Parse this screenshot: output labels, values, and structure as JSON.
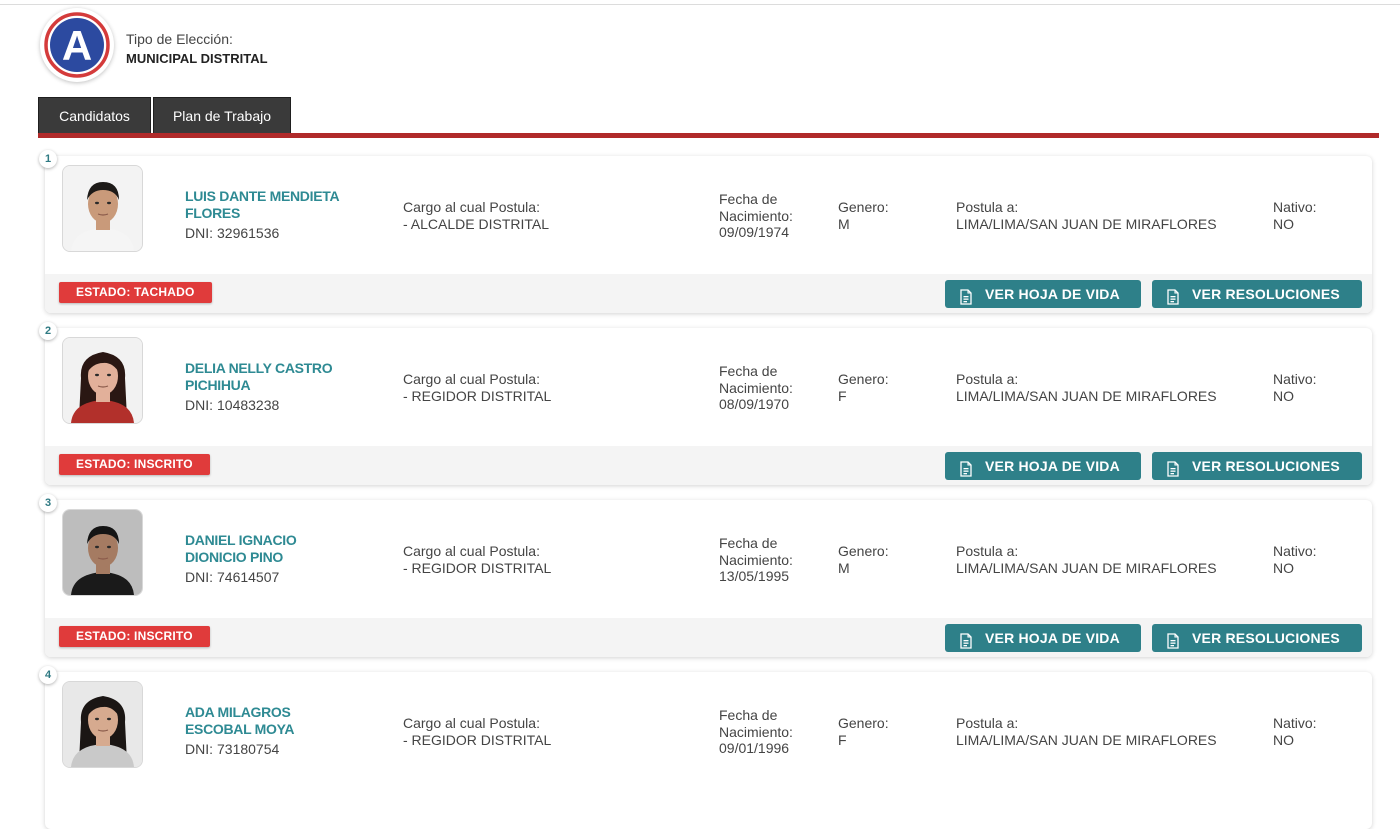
{
  "header": {
    "logo_letter": "A",
    "election_type_label": "Tipo de Elección:",
    "election_type_value": "MUNICIPAL DISTRITAL"
  },
  "tabs": [
    {
      "label": "Candidatos"
    },
    {
      "label": "Plan de Trabajo"
    }
  ],
  "labels": {
    "dni": "DNI:",
    "cargo": "Cargo al cual Postula:",
    "fecha_line1": "Fecha de",
    "fecha_line2": "Nacimiento:",
    "genero": "Genero:",
    "postula": "Postula a:",
    "nativo": "Nativo:",
    "btn_hoja": "VER HOJA DE VIDA",
    "btn_resoluciones": "VER RESOLUCIONES"
  },
  "colors": {
    "accent_teal": "#2e8089",
    "name_teal": "#2e8a93",
    "status_red": "#e03b3b",
    "tab_bar_red": "#b02a2a"
  },
  "candidates": [
    {
      "number": "1",
      "name_line1": "LUIS DANTE MENDIETA",
      "name_line2": "FLORES",
      "dni": "32961536",
      "cargo": "- ALCALDE DISTRITAL",
      "fecha": "09/09/1974",
      "genero": "M",
      "postula": "LIMA/LIMA/SAN JUAN DE MIRAFLORES",
      "nativo": "NO",
      "estado": "ESTADO: TACHADO"
    },
    {
      "number": "2",
      "name_line1": "DELIA NELLY CASTRO",
      "name_line2": "PICHIHUA",
      "dni": "10483238",
      "cargo": "- REGIDOR DISTRITAL",
      "fecha": "08/09/1970",
      "genero": "F",
      "postula": "LIMA/LIMA/SAN JUAN DE MIRAFLORES",
      "nativo": "NO",
      "estado": "ESTADO: INSCRITO"
    },
    {
      "number": "3",
      "name_line1": "DANIEL IGNACIO",
      "name_line2": "DIONICIO PINO",
      "dni": "74614507",
      "cargo": "- REGIDOR DISTRITAL",
      "fecha": "13/05/1995",
      "genero": "M",
      "postula": "LIMA/LIMA/SAN JUAN DE MIRAFLORES",
      "nativo": "NO",
      "estado": "ESTADO: INSCRITO"
    },
    {
      "number": "4",
      "name_line1": "ADA MILAGROS",
      "name_line2": "ESCOBAL MOYA",
      "dni": "73180754",
      "cargo": "- REGIDOR DISTRITAL",
      "fecha": "09/01/1996",
      "genero": "F",
      "postula": "LIMA/LIMA/SAN JUAN DE MIRAFLORES",
      "nativo": "NO",
      "estado": ""
    }
  ]
}
